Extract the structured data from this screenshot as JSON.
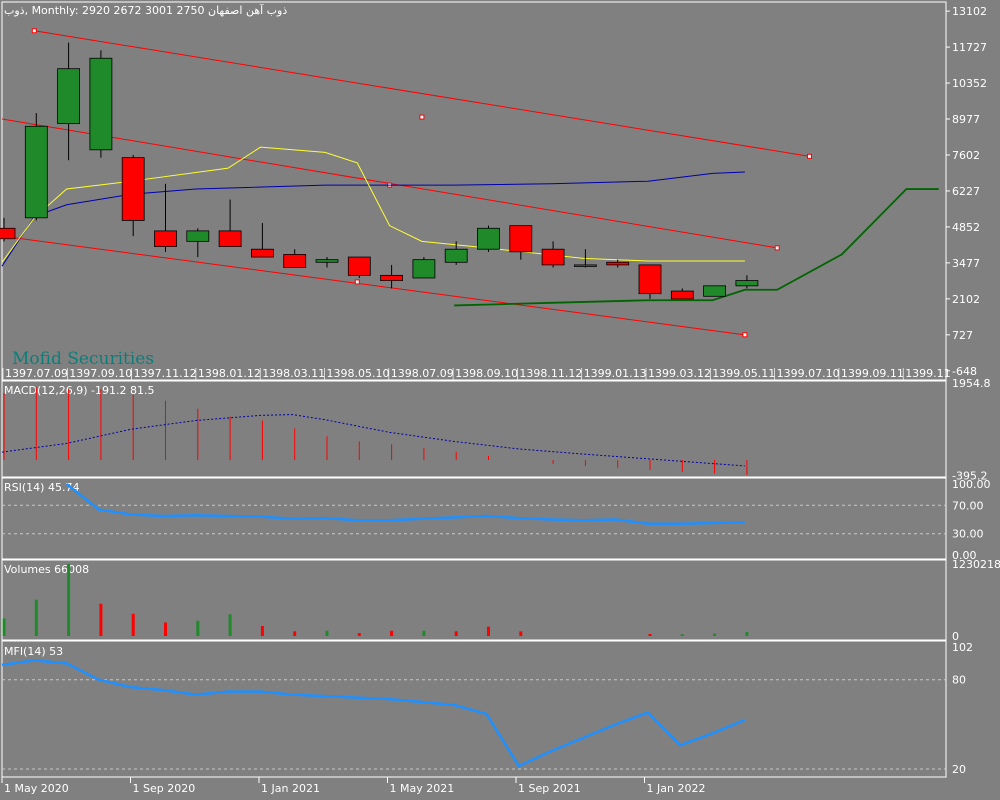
{
  "header": {
    "symbol": "ذوب",
    "timeframe": "Monthly",
    "ohlc": "2920 2672 3001 2750",
    "name": "ذوب آهن اصفهان"
  },
  "watermark": "Mofid Securities",
  "colors": {
    "background": "#808080",
    "bull": "#1f8a2a",
    "bear": "#ff0000",
    "channel": "#ff0000",
    "ma_fast": "#ffff33",
    "ma_slow": "#0000aa",
    "green_line": "#006400",
    "indicator": "#1e90ff",
    "macd_signal": "#0000aa",
    "grid": "#c8c8c8",
    "text": "#ffffff"
  },
  "chart_data": [
    {
      "type": "candlestick",
      "title": "ذوب, Monthly",
      "y_ticks": [
        "13102",
        "11727",
        "10352",
        "8977",
        "7602",
        "6227",
        "4852",
        "3477",
        "2102",
        "727",
        "-648"
      ],
      "x_labels": [
        "1397.07.09",
        "1397.09.10",
        "1397.11.12",
        "1398.01.12",
        "1398.03.11",
        "1398.05.10",
        "1398.07.09",
        "1398.09.10",
        "1398.11.12",
        "1399.01.13",
        "1399.03.12",
        "1399.05.11",
        "1399.07.10",
        "1399.09.11",
        "1399.11"
      ],
      "ylim": [
        -648,
        13102
      ],
      "candles": [
        {
          "o": 4800,
          "h": 5200,
          "l": 4300,
          "c": 4400
        },
        {
          "o": 5200,
          "h": 9200,
          "l": 5100,
          "c": 8700
        },
        {
          "o": 8800,
          "h": 11900,
          "l": 7400,
          "c": 10900
        },
        {
          "o": 7800,
          "h": 11600,
          "l": 7500,
          "c": 11300
        },
        {
          "o": 7500,
          "h": 7600,
          "l": 4500,
          "c": 5100
        },
        {
          "o": 4700,
          "h": 6500,
          "l": 3900,
          "c": 4100
        },
        {
          "o": 4300,
          "h": 4800,
          "l": 3700,
          "c": 4700
        },
        {
          "o": 4700,
          "h": 5900,
          "l": 4100,
          "c": 4100
        },
        {
          "o": 4000,
          "h": 5000,
          "l": 3700,
          "c": 3700
        },
        {
          "o": 3800,
          "h": 4000,
          "l": 3300,
          "c": 3300
        },
        {
          "o": 3500,
          "h": 3700,
          "l": 3300,
          "c": 3600
        },
        {
          "o": 3700,
          "h": 3700,
          "l": 2900,
          "c": 3000
        },
        {
          "o": 3000,
          "h": 3400,
          "l": 2500,
          "c": 2800
        },
        {
          "o": 2900,
          "h": 3700,
          "l": 2900,
          "c": 3600
        },
        {
          "o": 3500,
          "h": 4300,
          "l": 3400,
          "c": 4000
        },
        {
          "o": 4000,
          "h": 4900,
          "l": 3900,
          "c": 4800
        },
        {
          "o": 4900,
          "h": 4900,
          "l": 3600,
          "c": 3900
        },
        {
          "o": 4000,
          "h": 4300,
          "l": 3300,
          "c": 3400
        },
        {
          "o": 3400,
          "h": 4000,
          "l": 3300,
          "c": 3400
        },
        {
          "o": 3500,
          "h": 3600,
          "l": 3300,
          "c": 3400
        },
        {
          "o": 3400,
          "h": 3400,
          "l": 2100,
          "c": 2300
        },
        {
          "o": 2400,
          "h": 2500,
          "l": 2100,
          "c": 2100
        },
        {
          "o": 2200,
          "h": 2600,
          "l": 2200,
          "c": 2600
        },
        {
          "o": 2600,
          "h": 3000,
          "l": 2500,
          "c": 2800
        }
      ],
      "ma_fast": [
        [
          0,
          3500
        ],
        [
          1,
          5200
        ],
        [
          2,
          6300
        ],
        [
          4,
          6600
        ],
        [
          7,
          7100
        ],
        [
          8,
          7900
        ],
        [
          10,
          7700
        ],
        [
          11,
          7300
        ],
        [
          12,
          4900
        ],
        [
          13,
          4300
        ],
        [
          15,
          4050
        ],
        [
          18,
          3650
        ],
        [
          20,
          3550
        ],
        [
          23,
          3550
        ]
      ],
      "ma_slow": [
        [
          0,
          3350
        ],
        [
          1,
          5250
        ],
        [
          2,
          5700
        ],
        [
          4,
          6100
        ],
        [
          6,
          6300
        ],
        [
          10,
          6450
        ],
        [
          14,
          6450
        ],
        [
          17,
          6500
        ],
        [
          20,
          6600
        ],
        [
          22,
          6900
        ],
        [
          23,
          6950
        ]
      ],
      "green_line": [
        [
          14,
          1850
        ],
        [
          17,
          1950
        ],
        [
          20,
          2050
        ],
        [
          22,
          2050
        ],
        [
          23,
          2450
        ],
        [
          24,
          2450
        ],
        [
          26,
          3800
        ],
        [
          28,
          6300
        ],
        [
          29,
          6300
        ]
      ],
      "channel_lines": [
        {
          "from": [
            1,
            12350
          ],
          "to": [
            25,
            7550
          ],
          "markers": [
            [
              1,
              12350
            ],
            [
              13,
              9050
            ],
            [
              25,
              7550
            ]
          ]
        },
        {
          "from": [
            0,
            8977
          ],
          "to": [
            24,
            4050
          ],
          "markers": [
            [
              12,
              6450
            ],
            [
              24,
              4050
            ]
          ]
        },
        {
          "from": [
            0,
            4500
          ],
          "to": [
            23,
            727
          ],
          "markers": [
            [
              11,
              2750
            ],
            [
              23,
              727
            ]
          ]
        }
      ]
    },
    {
      "type": "bar",
      "title": "MACD(12,26,9) -191.2 81.5",
      "ylim": [
        -395.2,
        1954.8
      ],
      "y_ticks": [
        "1954.8",
        "-395.2"
      ],
      "histogram": [
        1700,
        1850,
        1800,
        1800,
        1650,
        1500,
        1300,
        1100,
        1000,
        800,
        600,
        470,
        400,
        300,
        200,
        100,
        0,
        -100,
        -150,
        -200,
        -250,
        -300,
        -340,
        -380
      ],
      "signal": [
        [
          0,
          200
        ],
        [
          2,
          420
        ],
        [
          4,
          780
        ],
        [
          6,
          1000
        ],
        [
          8,
          1130
        ],
        [
          9,
          1150
        ],
        [
          10,
          1020
        ],
        [
          12,
          700
        ],
        [
          14,
          470
        ],
        [
          16,
          280
        ],
        [
          18,
          150
        ],
        [
          20,
          30
        ],
        [
          22,
          -90
        ],
        [
          23,
          -150
        ]
      ]
    },
    {
      "type": "line",
      "title": "RSI(14) 45.74",
      "ylim": [
        0,
        100
      ],
      "y_ticks": [
        "100.00",
        "70.00",
        "30.00",
        "0.00"
      ],
      "levels": [
        70,
        30
      ],
      "values": [
        [
          2,
          100
        ],
        [
          3,
          64
        ],
        [
          4,
          57
        ],
        [
          5,
          55
        ],
        [
          6,
          56
        ],
        [
          7,
          55
        ],
        [
          8,
          54
        ],
        [
          9,
          51
        ],
        [
          10,
          52
        ],
        [
          11,
          49
        ],
        [
          12,
          49
        ],
        [
          13,
          51
        ],
        [
          14,
          53
        ],
        [
          15,
          55
        ],
        [
          16,
          52
        ],
        [
          17,
          50
        ],
        [
          18,
          49
        ],
        [
          19,
          50
        ],
        [
          20,
          44
        ],
        [
          21,
          44
        ],
        [
          22,
          45
        ],
        [
          23,
          46
        ]
      ]
    },
    {
      "type": "bar",
      "title": "Volumes 66008",
      "ylim": [
        0,
        1230218
      ],
      "y_ticks": [
        "1230218",
        "0"
      ],
      "volumes": [
        300000,
        620000,
        1230218,
        550000,
        380000,
        230000,
        260000,
        370000,
        170000,
        80000,
        90000,
        50000,
        90000,
        90000,
        80000,
        160000,
        80000,
        0,
        0,
        0,
        35000,
        30000,
        40000,
        66008
      ],
      "bull": [
        true,
        true,
        true,
        false,
        false,
        false,
        true,
        true,
        false,
        false,
        true,
        false,
        false,
        true,
        false,
        false,
        false,
        true,
        true,
        false,
        false,
        true,
        true,
        true
      ]
    },
    {
      "type": "line",
      "title": "MFI(14) 53",
      "ylim": [
        20,
        102
      ],
      "y_ticks": [
        "102",
        "80",
        "20"
      ],
      "levels": [
        80,
        20
      ],
      "values": [
        [
          0,
          90
        ],
        [
          1,
          93
        ],
        [
          2,
          91
        ],
        [
          3,
          80
        ],
        [
          4,
          75
        ],
        [
          5,
          73
        ],
        [
          6,
          70
        ],
        [
          7,
          72
        ],
        [
          8,
          72
        ],
        [
          9,
          70
        ],
        [
          10,
          69
        ],
        [
          11,
          68
        ],
        [
          12,
          67
        ],
        [
          13,
          65
        ],
        [
          14,
          63
        ],
        [
          15,
          57
        ],
        [
          16,
          22
        ],
        [
          17,
          32
        ],
        [
          18,
          41
        ],
        [
          19,
          50
        ],
        [
          20,
          58
        ],
        [
          21,
          36
        ],
        [
          22,
          44
        ],
        [
          23,
          53
        ]
      ]
    }
  ],
  "time_axis": [
    "1 May 2020",
    "1 Sep 2020",
    "1 Jan 2021",
    "1 May 2021",
    "1 Sep 2021",
    "1 Jan 2022"
  ]
}
